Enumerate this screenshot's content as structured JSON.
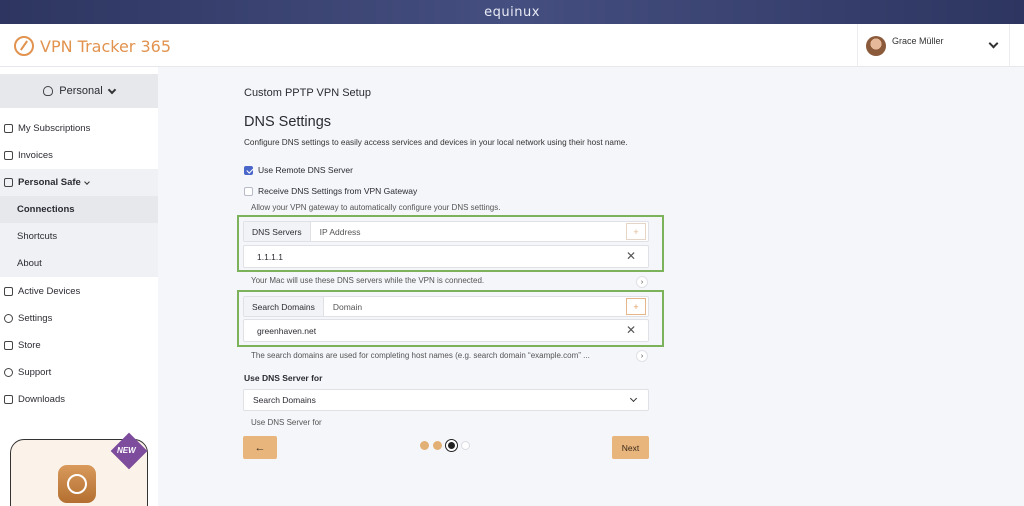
{
  "topbar": {
    "brand": "equinux"
  },
  "header": {
    "app_name": "VPN Tracker 365",
    "user_name": "Grace Müller"
  },
  "sidebar": {
    "account_switcher": "Personal",
    "items": [
      {
        "label": "My Subscriptions",
        "icon": "layers-icon"
      },
      {
        "label": "Invoices",
        "icon": "invoice-icon"
      },
      {
        "label": "Personal Safe",
        "icon": "safe-icon"
      },
      {
        "label": "Connections"
      },
      {
        "label": "Shortcuts"
      },
      {
        "label": "About"
      },
      {
        "label": "Active Devices",
        "icon": "devices-icon"
      },
      {
        "label": "Settings",
        "icon": "gear-icon"
      },
      {
        "label": "Store",
        "icon": "store-icon"
      },
      {
        "label": "Support",
        "icon": "support-icon"
      },
      {
        "label": "Downloads",
        "icon": "download-icon"
      }
    ],
    "promo_badge": "NEW"
  },
  "main": {
    "setup_title": "Custom PPTP VPN Setup",
    "section_title": "DNS Settings",
    "description": "Configure DNS settings to easily access services and devices in your local network using their host name.",
    "use_remote_dns": {
      "label": "Use Remote DNS Server",
      "checked": true
    },
    "receive_dns": {
      "label": "Receive DNS Settings from VPN Gateway",
      "checked": false
    },
    "receive_dns_hint": "Allow your VPN gateway to automatically configure your DNS settings.",
    "dns_servers": {
      "label": "DNS Servers",
      "placeholder": "IP Address",
      "add": "+",
      "value": "1.1.1.1",
      "hint": "Your Mac will use these DNS servers while the VPN is connected."
    },
    "search_domains": {
      "label": "Search Domains",
      "placeholder": "Domain",
      "add": "+",
      "value": "greenhaven.net",
      "hint": "The search domains are used for completing host names (e.g. search domain “example.com” ..."
    },
    "use_dns_for": {
      "label": "Use DNS Server for",
      "selected": "Search Domains",
      "hint": "Use DNS Server for"
    },
    "buttons": {
      "back": "←",
      "next": "Next"
    },
    "pager": {
      "total": 4,
      "current": 3
    }
  },
  "colors": {
    "accent": "#e8b57d",
    "highlight": "#7cb35a",
    "checkbox": "#4a66c8"
  }
}
